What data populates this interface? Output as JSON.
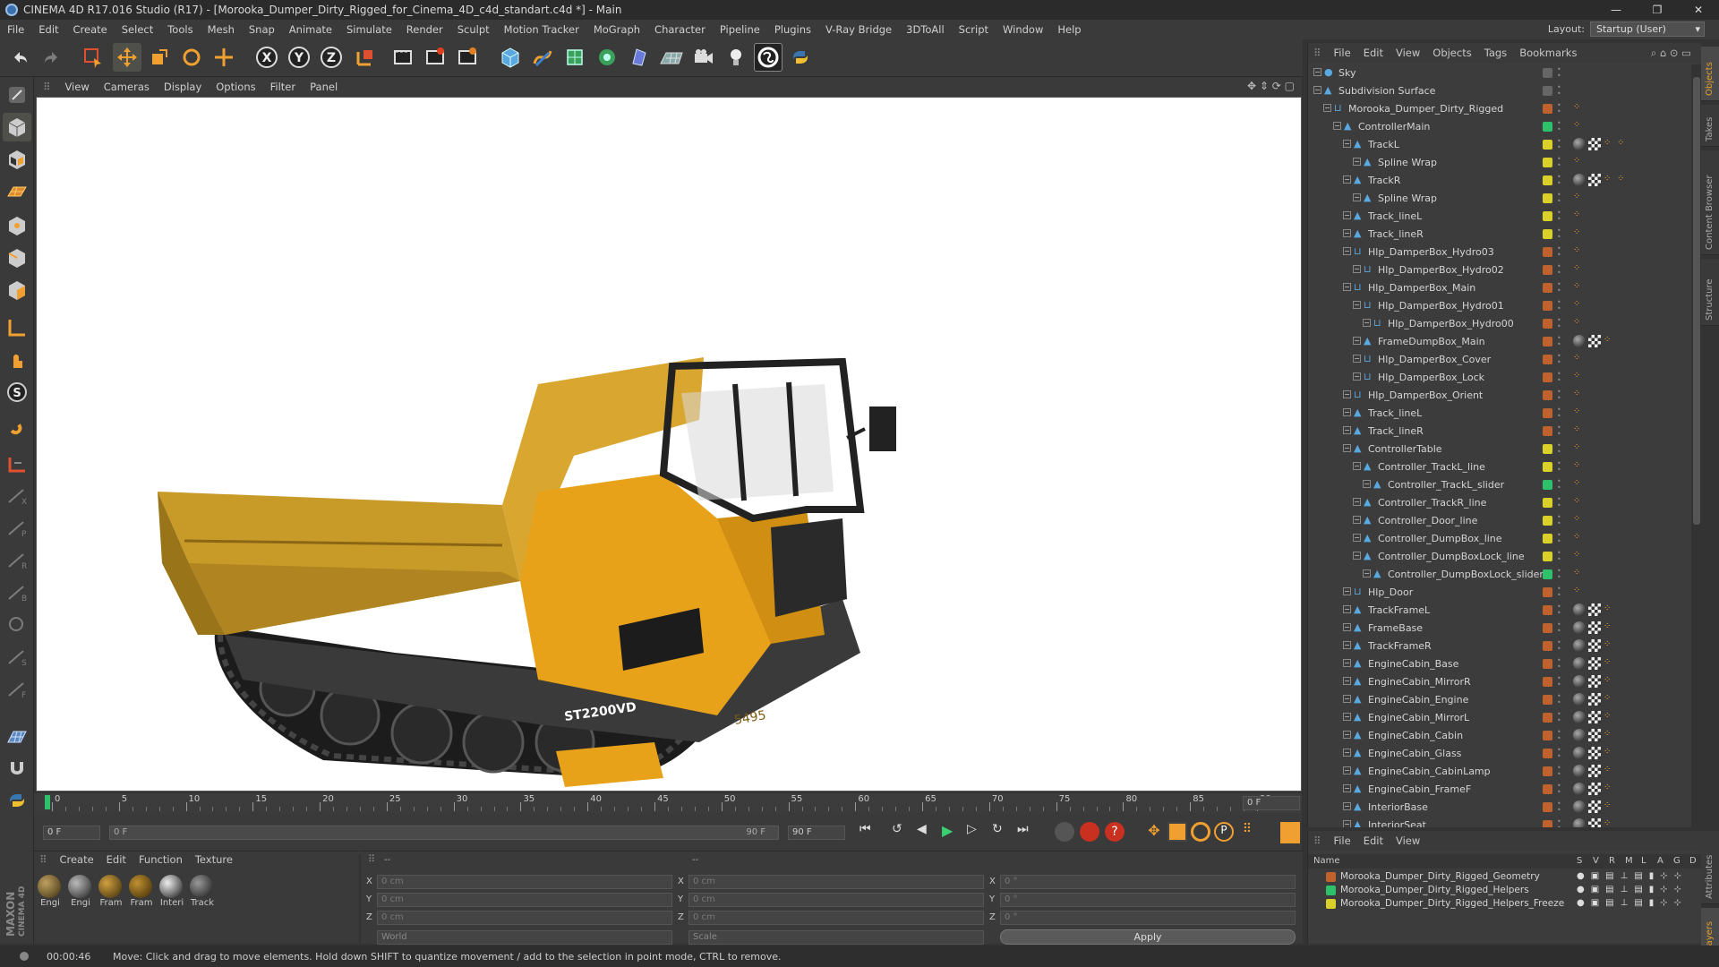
{
  "window": {
    "title": "CINEMA 4D R17.016 Studio (R17) - [Morooka_Dumper_Dirty_Rigged_for_Cinema_4D_c4d_standart.c4d *] - Main",
    "controls": [
      "—",
      "❐",
      "✕"
    ]
  },
  "menu": [
    "File",
    "Edit",
    "Create",
    "Select",
    "Tools",
    "Mesh",
    "Snap",
    "Animate",
    "Simulate",
    "Render",
    "Sculpt",
    "Motion Tracker",
    "MoGraph",
    "Character",
    "Pipeline",
    "Plugins",
    "V-Ray Bridge",
    "3DToAll",
    "Script",
    "Window",
    "Help"
  ],
  "layout": {
    "label": "Layout:",
    "value": "Startup (User)"
  },
  "viewport_menu": [
    "View",
    "Cameras",
    "Display",
    "Options",
    "Filter",
    "Panel"
  ],
  "timeline": {
    "ticks": [
      "0",
      "5",
      "10",
      "15",
      "20",
      "25",
      "30",
      "35",
      "40",
      "45",
      "50",
      "55",
      "60",
      "65",
      "70",
      "75",
      "80",
      "85",
      "90"
    ],
    "current_frame": "0 F",
    "start_field": "0 F",
    "range_left": "0 F",
    "range_right": "90 F",
    "end_field": "90 F"
  },
  "material_manager": {
    "menu": [
      "Create",
      "Edit",
      "Function",
      "Texture"
    ],
    "materials": [
      "Engi",
      "Engi",
      "Fram",
      "Fram",
      "Interi",
      "Track"
    ]
  },
  "coordinates": {
    "col1": [
      {
        "axis": "X",
        "value": "0 cm"
      },
      {
        "axis": "Y",
        "value": "0 cm"
      },
      {
        "axis": "Z",
        "value": "0 cm"
      }
    ],
    "col2": [
      {
        "axis": "X",
        "value": "0 cm"
      },
      {
        "axis": "Y",
        "value": "0 cm"
      },
      {
        "axis": "Z",
        "value": "0 cm"
      }
    ],
    "col3": [
      {
        "axis": "X",
        "value": "0 °"
      },
      {
        "axis": "Y",
        "value": "0 °"
      },
      {
        "axis": "Z",
        "value": "0 °"
      }
    ],
    "header1": "--",
    "header2": "--",
    "world": "World",
    "scale": "Scale",
    "apply": "Apply"
  },
  "object_manager": {
    "menu": [
      "File",
      "Edit",
      "View",
      "Objects",
      "Tags",
      "Bookmarks"
    ],
    "objects": [
      {
        "name": "Sky",
        "indent": 0
      },
      {
        "name": "Subdivision Surface",
        "indent": 0
      },
      {
        "name": "Morooka_Dumper_Dirty_Rigged",
        "indent": 1
      },
      {
        "name": "ControllerMain",
        "indent": 2
      },
      {
        "name": "TrackL",
        "indent": 3
      },
      {
        "name": "Spline Wrap",
        "indent": 4
      },
      {
        "name": "TrackR",
        "indent": 3
      },
      {
        "name": "Spline Wrap",
        "indent": 4
      },
      {
        "name": "Track_lineL",
        "indent": 3
      },
      {
        "name": "Track_lineR",
        "indent": 3
      },
      {
        "name": "Hlp_DamperBox_Hydro03",
        "indent": 3
      },
      {
        "name": "Hlp_DamperBox_Hydro02",
        "indent": 4
      },
      {
        "name": "Hlp_DamperBox_Main",
        "indent": 3
      },
      {
        "name": "Hlp_DamperBox_Hydro01",
        "indent": 4
      },
      {
        "name": "Hlp_DamperBox_Hydro00",
        "indent": 5
      },
      {
        "name": "FrameDumpBox_Main",
        "indent": 4
      },
      {
        "name": "Hlp_DamperBox_Cover",
        "indent": 4
      },
      {
        "name": "Hlp_DamperBox_Lock",
        "indent": 4
      },
      {
        "name": "Hlp_DamperBox_Orient",
        "indent": 3
      },
      {
        "name": "Track_lineL",
        "indent": 3
      },
      {
        "name": "Track_lineR",
        "indent": 3
      },
      {
        "name": "ControllerTable",
        "indent": 3
      },
      {
        "name": "Controller_TrackL_line",
        "indent": 4
      },
      {
        "name": "Controller_TrackL_slider",
        "indent": 5
      },
      {
        "name": "Controller_TrackR_line",
        "indent": 4
      },
      {
        "name": "Controller_Door_line",
        "indent": 4
      },
      {
        "name": "Controller_DumpBox_line",
        "indent": 4
      },
      {
        "name": "Controller_DumpBoxLock_line",
        "indent": 4
      },
      {
        "name": "Controller_DumpBoxLock_slider",
        "indent": 5
      },
      {
        "name": "Hlp_Door",
        "indent": 3
      },
      {
        "name": "TrackFrameL",
        "indent": 3
      },
      {
        "name": "FrameBase",
        "indent": 3
      },
      {
        "name": "TrackFrameR",
        "indent": 3
      },
      {
        "name": "EngineCabin_Base",
        "indent": 3
      },
      {
        "name": "EngineCabin_MirrorR",
        "indent": 3
      },
      {
        "name": "EngineCabin_Engine",
        "indent": 3
      },
      {
        "name": "EngineCabin_MirrorL",
        "indent": 3
      },
      {
        "name": "EngineCabin_Cabin",
        "indent": 3
      },
      {
        "name": "EngineCabin_Glass",
        "indent": 3
      },
      {
        "name": "EngineCabin_CabinLamp",
        "indent": 3
      },
      {
        "name": "EngineCabin_FrameF",
        "indent": 3
      },
      {
        "name": "InteriorBase",
        "indent": 3
      },
      {
        "name": "InteriorSeat",
        "indent": 3
      }
    ]
  },
  "layer_manager": {
    "menu": [
      "File",
      "Edit",
      "View"
    ],
    "header_name": "Name",
    "header_cols": [
      "S",
      "V",
      "R",
      "M",
      "L",
      "A",
      "G",
      "D"
    ],
    "layers": [
      {
        "name": "Morooka_Dumper_Dirty_Rigged_Geometry",
        "color": "#c0622e"
      },
      {
        "name": "Morooka_Dumper_Dirty_Rigged_Helpers",
        "color": "#2ec06a"
      },
      {
        "name": "Morooka_Dumper_Dirty_Rigged_Helpers_Freeze",
        "color": "#d9d12a"
      }
    ]
  },
  "right_tabs": [
    "Objects",
    "Takes",
    "Content Browser",
    "Structure",
    "Attributes",
    "Layers"
  ],
  "status": {
    "time": "00:00:46",
    "message": "Move: Click and drag to move elements. Hold down SHIFT to quantize movement / add to the selection in point mode, CTRL to remove."
  },
  "brand": {
    "maxon": "MAXON",
    "product": "CINEMA 4D"
  },
  "model_decals": {
    "badge": "ST2200VD",
    "number": "5495"
  },
  "colors": {
    "accent_yellow": "#e8a21a",
    "layer_orange": "#c0622e",
    "layer_green": "#2ec06a",
    "layer_yellow": "#d9d12a"
  }
}
